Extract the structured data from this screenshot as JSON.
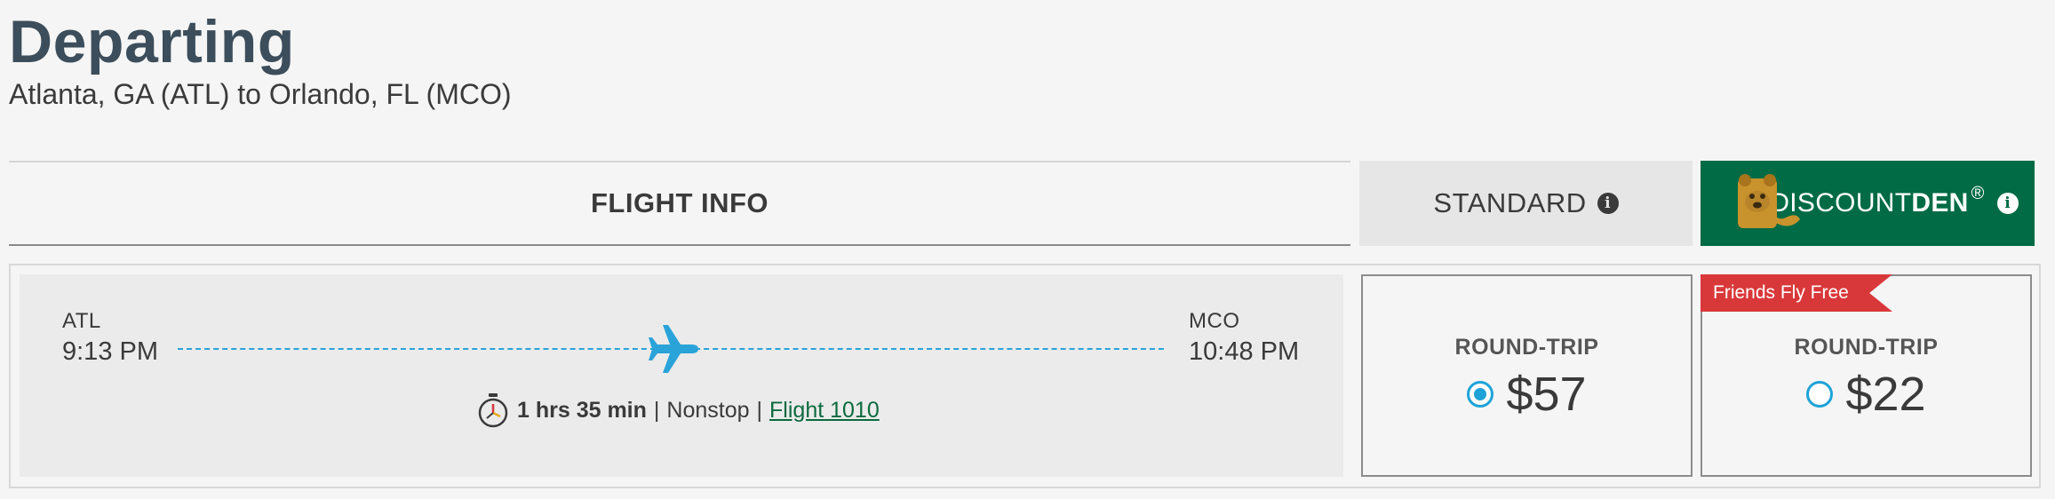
{
  "header": {
    "title": "Departing",
    "subtitle": "Atlanta, GA (ATL) to Orlando, FL (MCO)"
  },
  "columns": {
    "flight_info": "FLIGHT INFO",
    "standard": "STANDARD",
    "den_brand_part1": "DISCOUNT",
    "den_brand_part2": "DEN",
    "den_registered": "®",
    "info_glyph": "i"
  },
  "flight": {
    "origin_code": "ATL",
    "depart_time": "9:13 PM",
    "destination_code": "MCO",
    "arrive_time": "10:48 PM",
    "duration": "1 hrs 35 min",
    "separator": "|",
    "stops": "Nonstop",
    "flight_number": "Flight 1010"
  },
  "fares": {
    "standard": {
      "label": "ROUND-TRIP",
      "price": "$57",
      "selected": true
    },
    "den": {
      "label": "ROUND-TRIP",
      "price": "$22",
      "selected": false,
      "ribbon": "Friends Fly Free"
    }
  },
  "icons": {
    "plane": "plane-icon",
    "stopwatch": "stopwatch-icon",
    "info": "info-icon",
    "bear_logo": "bear-logo-icon"
  },
  "colors": {
    "title": "#3c4d5b",
    "den_green": "#006b45",
    "accent_blue": "#1ea3d8",
    "ribbon_red": "#d9383a",
    "link_green": "#0b6a3f"
  }
}
